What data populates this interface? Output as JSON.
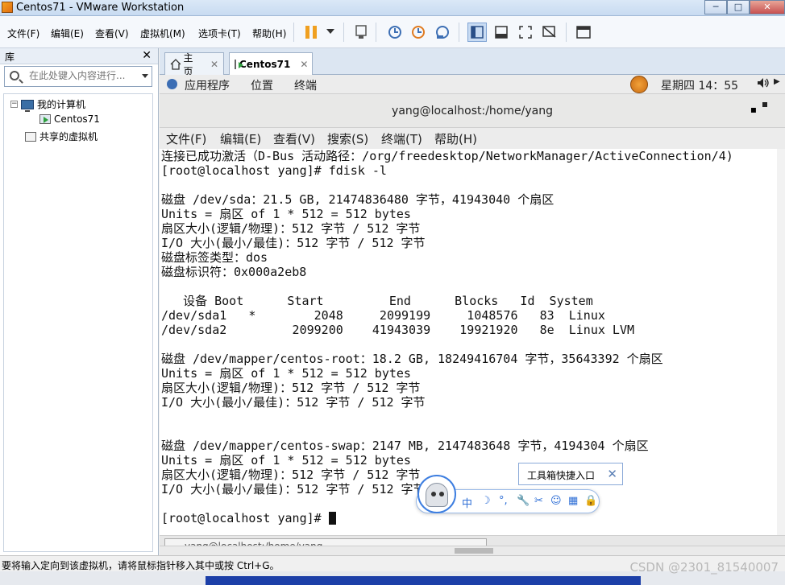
{
  "window": {
    "title": "Centos71 - VMware Workstation",
    "min": "─",
    "max": "□",
    "close": "✕"
  },
  "menubar": {
    "items": [
      "文件(F)",
      "编辑(E)",
      "查看(V)",
      "虚拟机(M)",
      "选项卡(T)",
      "帮助(H)"
    ]
  },
  "library": {
    "title": "库",
    "close": "✕",
    "search_placeholder": "在此处键入内容进行...",
    "tree": {
      "my_computer": "我的计算机",
      "vm": "Centos71",
      "shared": "共享的虚拟机"
    }
  },
  "tabs": [
    {
      "label": "主页",
      "close": "✕"
    },
    {
      "label": "Centos71",
      "close": "✕"
    }
  ],
  "gnome": {
    "applications": "应用程序",
    "places": "位置",
    "terminal": "终端",
    "clock": "星期四 14：55",
    "volume_icon": "speaker-icon"
  },
  "terminal": {
    "title": "yang@localhost:/home/yang",
    "menu": [
      "文件(F)",
      "编辑(E)",
      "查看(V)",
      "搜索(S)",
      "终端(T)",
      "帮助(H)"
    ],
    "lines": [
      "连接已成功激活（D-Bus 活动路径：/org/freedesktop/NetworkManager/ActiveConnection/4)",
      "[root@localhost yang]# fdisk -l",
      "",
      "磁盘 /dev/sda：21.5 GB, 21474836480 字节，41943040 个扇区",
      "Units = 扇区 of 1 * 512 = 512 bytes",
      "扇区大小(逻辑/物理)：512 字节 / 512 字节",
      "I/O 大小(最小/最佳)：512 字节 / 512 字节",
      "磁盘标签类型：dos",
      "磁盘标识符：0x000a2eb8",
      "",
      "   设备 Boot      Start         End      Blocks   Id  System",
      "/dev/sda1   *        2048     2099199     1048576   83  Linux",
      "/dev/sda2         2099200    41943039    19921920   8e  Linux LVM",
      "",
      "磁盘 /dev/mapper/centos-root：18.2 GB, 18249416704 字节，35643392 个扇区",
      "Units = 扇区 of 1 * 512 = 512 bytes",
      "扇区大小(逻辑/物理)：512 字节 / 512 字节",
      "I/O 大小(最小/最佳)：512 字节 / 512 字节",
      "",
      "",
      "磁盘 /dev/mapper/centos-swap：2147 MB, 2147483648 字节，4194304 个扇区",
      "Units = 扇区 of 1 * 512 = 512 bytes",
      "扇区大小(逻辑/物理)：512 字节 / 512 字节",
      "I/O 大小(最小/最佳)：512 字节 / 512 字节",
      ""
    ],
    "prompt": "[root@localhost yang]# ",
    "taskbar_item": "yang@localhost:/home/yang"
  },
  "ime": {
    "tooltip": "工具箱快捷入口",
    "tooltip_close": "✕",
    "glyphs": [
      "中",
      "☽",
      "°,",
      "🔧",
      "✂",
      "☺",
      "▦",
      "🔒"
    ]
  },
  "statusbar": {
    "text": "要将输入定向到该虚拟机，请将鼠标指针移入其中或按 Ctrl+G。",
    "watermark": "CSDN @2301_81540007"
  },
  "colors": {
    "accent": "#3d7ee0",
    "pause": "#f0a020"
  }
}
